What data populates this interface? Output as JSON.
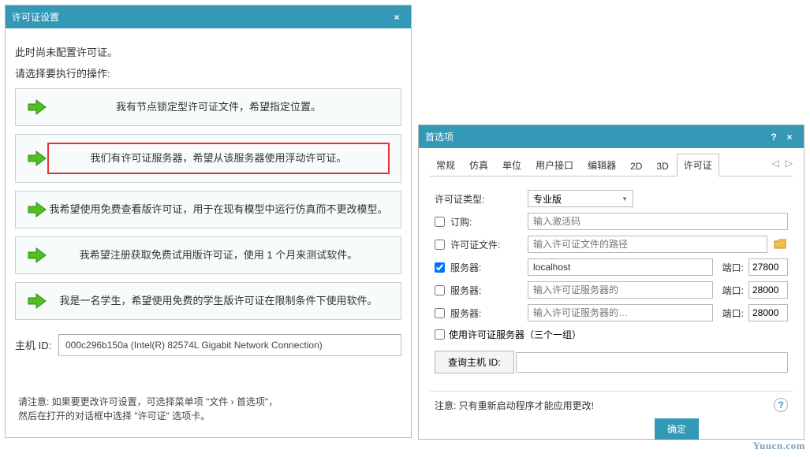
{
  "win1": {
    "title": "许可证设置",
    "intro": "此时尚未配置许可证。",
    "prompt": "请选择要执行的操作:",
    "options": {
      "opt1": "我有节点锁定型许可证文件，希望指定位置。",
      "opt2": "我们有许可证服务器，希望从该服务器使用浮动许可证。",
      "opt3": "我希望使用免费查看版许可证，用于在现有模型中运行仿真而不更改模型。",
      "opt4": "我希望注册获取免费试用版许可证，使用 1 个月来测试软件。",
      "opt5": "我是一名学生，希望使用免费的学生版许可证在限制条件下使用软件。"
    },
    "hostid_label": "主机 ID:",
    "hostid_value": "000c296b150a (Intel(R) 82574L Gigabit Network Connection)",
    "note1": "请注意: 如果要更改许可设置，可选择菜单项 \"文件 › 首选项\"，",
    "note2": "然后在打开的对话框中选择 \"许可证\" 选项卡。"
  },
  "win2": {
    "title": "首选项",
    "tabs": {
      "t1": "常规",
      "t2": "仿真",
      "t3": "单位",
      "t4": "用户接口",
      "t5": "编辑器",
      "t6": "2D",
      "t7": "3D",
      "t8": "许可证"
    },
    "form": {
      "license_type_label": "许可证类型:",
      "license_type_value": "专业版",
      "order_label": "订购:",
      "order_placeholder": "输入激活码",
      "file_label": "许可证文件:",
      "file_placeholder": "输入许可证文件的路径",
      "server1_label": "服务器:",
      "server1_value": "localhost",
      "port_label": "端口:",
      "port1": "27800",
      "server2_label": "服务器:",
      "server2_placeholder": "输入许可证服务器的",
      "port2": "28000",
      "server3_label": "服务器:",
      "server3_placeholder": "输入许可证服务器的…",
      "port3": "28000",
      "triple_label": "使用许可证服务器（三个一组）",
      "query_host": "查询主机 ID:"
    },
    "warn": "注意: 只有重新启动程序才能应用更改!",
    "ok": "确定"
  },
  "watermark": "Yuucn.com"
}
